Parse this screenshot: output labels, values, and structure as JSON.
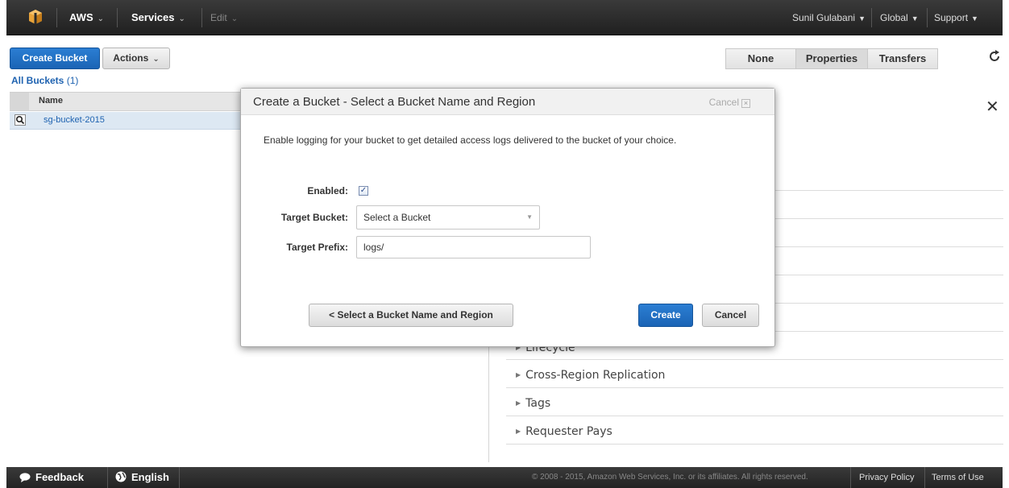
{
  "nav": {
    "aws_label": "AWS",
    "services_label": "Services",
    "edit_label": "Edit",
    "user_label": "Sunil Gulabani",
    "region_label": "Global",
    "support_label": "Support"
  },
  "toolbar": {
    "create_bucket_label": "Create Bucket",
    "actions_label": "Actions",
    "view_none_label": "None",
    "view_properties_label": "Properties",
    "view_transfers_label": "Transfers"
  },
  "buckets": {
    "heading": "All Buckets",
    "count": "(1)",
    "column_name": "Name",
    "rows": [
      {
        "name": "sg-bucket-2015"
      }
    ]
  },
  "properties": {
    "sections": [
      "Lifecycle",
      "Cross-Region Replication",
      "Tags",
      "Requester Pays"
    ]
  },
  "modal": {
    "title": "Create a Bucket - Select a Bucket Name and Region",
    "cancel_link": "Cancel",
    "description": "Enable logging for your bucket to get detailed access logs delivered to the bucket of your choice.",
    "enabled_label": "Enabled:",
    "enabled_checked": true,
    "target_bucket_label": "Target Bucket:",
    "target_bucket_value": "Select a Bucket",
    "target_prefix_label": "Target Prefix:",
    "target_prefix_value": "logs/",
    "back_button": "< Select a Bucket Name and Region",
    "create_button": "Create",
    "cancel_button": "Cancel"
  },
  "footer": {
    "feedback_label": "Feedback",
    "language_label": "English",
    "copyright": "© 2008 - 2015, Amazon Web Services, Inc. or its affiliates. All rights reserved.",
    "privacy_label": "Privacy Policy",
    "terms_label": "Terms of Use"
  },
  "colors": {
    "primary_blue": "#1b64b5",
    "nav_dark": "#232323",
    "selected_row": "#dde8f3"
  }
}
